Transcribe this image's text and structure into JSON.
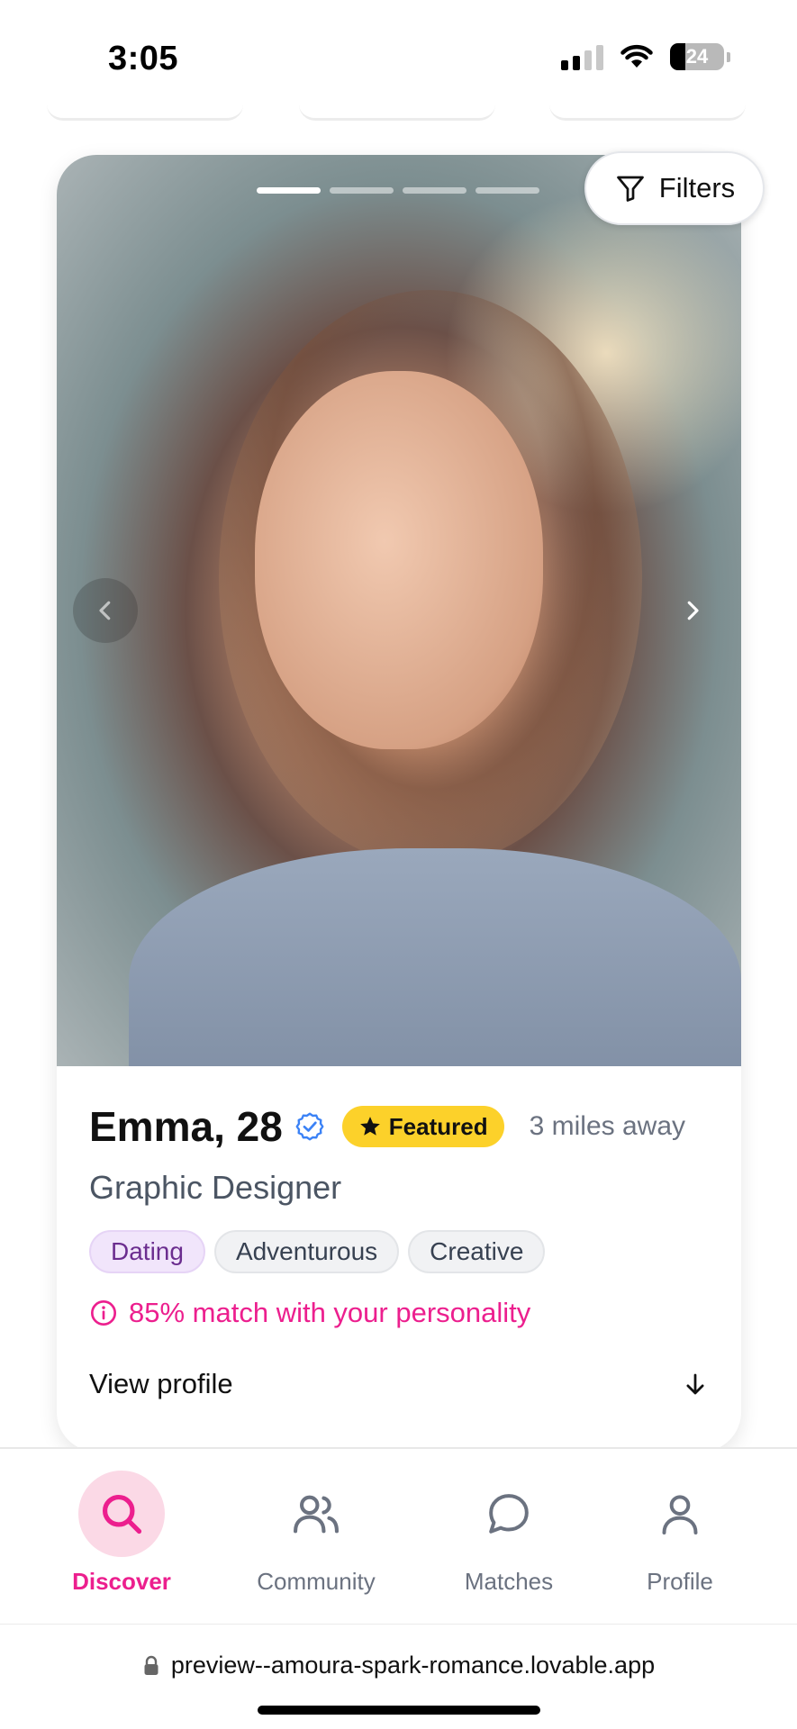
{
  "status_bar": {
    "time": "3:05",
    "battery": "24"
  },
  "card": {
    "photo_count": 4,
    "active_photo": 1,
    "name_age": "Emma, 28",
    "featured_label": "Featured",
    "distance": "3 miles away",
    "occupation": "Graphic Designer",
    "tags": [
      "Dating",
      "Adventurous",
      "Creative"
    ],
    "match_text": "85% match with your personality",
    "view_profile_label": "View profile"
  },
  "filters_label": "Filters",
  "bottom_nav": [
    {
      "label": "Discover",
      "icon": "search-icon",
      "active": true
    },
    {
      "label": "Community",
      "icon": "users-icon",
      "active": false
    },
    {
      "label": "Matches",
      "icon": "chat-bubble-icon",
      "active": false
    },
    {
      "label": "Profile",
      "icon": "user-icon",
      "active": false
    }
  ],
  "browser": {
    "url": "preview--amoura-spark-romance.lovable.app"
  },
  "colors": {
    "accent": "#ec1f8e",
    "featured": "#fcd12a",
    "verified": "#3b82f6"
  }
}
